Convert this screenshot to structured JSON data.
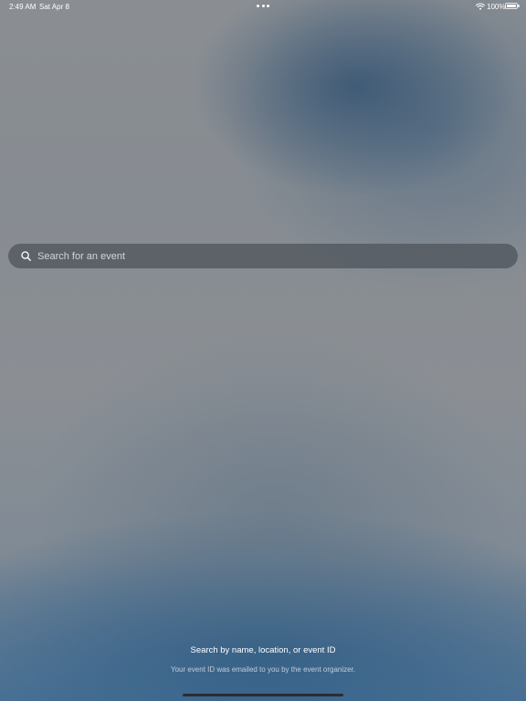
{
  "status_bar": {
    "time": "2:49 AM",
    "date": "Sat Apr 8",
    "battery_percent": "100%",
    "battery_level": 1.0,
    "wifi_icon": "wifi-icon",
    "battery_icon": "battery-icon",
    "multitask_icon": "ellipsis-icon"
  },
  "search": {
    "placeholder": "Search for an event",
    "value": "",
    "icon": "search-icon"
  },
  "hint": {
    "title": "Search by name, location, or event ID",
    "subtitle": "Your event ID was emailed to you by the event organizer."
  }
}
